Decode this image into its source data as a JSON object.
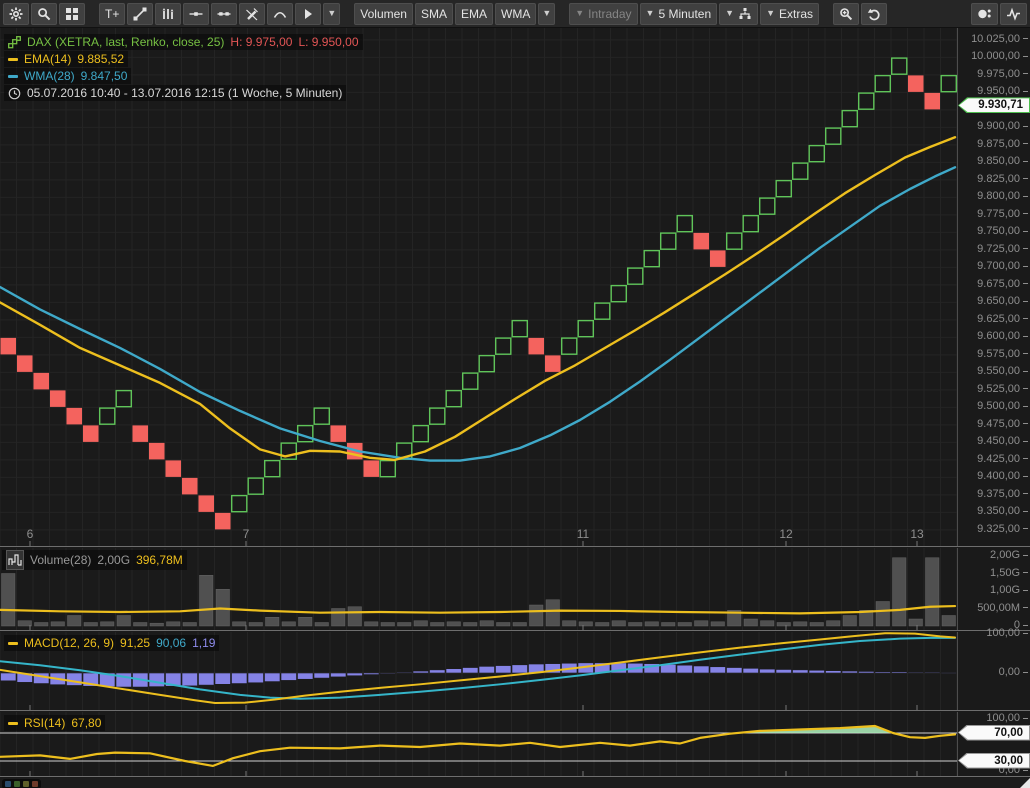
{
  "colors": {
    "up": "#5fc459",
    "down": "#f4635e",
    "ema": "#edbf1e",
    "wma": "#3fa9c9",
    "signal": "#35b5c9",
    "hist": "#8583e6",
    "volbar": "#505050",
    "rsi_fill": "#a9e7b6",
    "grid": "#242424",
    "axis_text": "#8f8f8f",
    "level_line": "#d0d0d0"
  },
  "toolbar": {
    "icons_left": [
      "gear-icon",
      "search-icon",
      "layout-grid-icon"
    ],
    "text_tool": "T+",
    "indicator_buttons": {
      "volumen": "Volumen",
      "sma": "SMA",
      "ema": "EMA",
      "wma": "WMA"
    },
    "dropdowns": {
      "intraday": "Intraday",
      "interval": "5 Minuten",
      "extras": "Extras"
    }
  },
  "legend": {
    "symbol": "DAX (XETRA, last, Renko, close, 25)",
    "high": "H: 9.975,00",
    "low": "L: 9.950,00",
    "ema_name": "EMA(14)",
    "ema_value": "9.885,52",
    "wma_name": "WMA(28)",
    "wma_value": "9.847,50",
    "range": "05.07.2016 10:40 - 13.07.2016 12:15 (1 Woche, 5 Minuten)"
  },
  "volume_legend": {
    "name": "Volume(28)",
    "scale": "2,00G",
    "value": "396,78M"
  },
  "macd_legend": {
    "name": "MACD(12, 26, 9)",
    "macd": "91,25",
    "signal": "90,06",
    "hist": "1,19"
  },
  "rsi_legend": {
    "name": "RSI(14)",
    "value": "67,80"
  },
  "price_tag": {
    "label": "9.930,71",
    "value": 9930.71
  },
  "chart_data": {
    "type": "renko+line",
    "x_labels": [
      [
        "6",
        30
      ],
      [
        "7",
        246
      ],
      [
        "11",
        583
      ],
      [
        "12",
        786
      ],
      [
        "13",
        917
      ]
    ],
    "main": {
      "brick_size": 25,
      "price_ticks": [
        [
          "10.025,00",
          10025
        ],
        [
          "10.000,00",
          10000
        ],
        [
          "9.975,00",
          9975
        ],
        [
          "9.950,00",
          9950
        ],
        [
          "9.900,00",
          9900
        ],
        [
          "9.875,00",
          9875
        ],
        [
          "9.850,00",
          9850
        ],
        [
          "9.825,00",
          9825
        ],
        [
          "9.800,00",
          9800
        ],
        [
          "9.775,00",
          9775
        ],
        [
          "9.750,00",
          9750
        ],
        [
          "9.725,00",
          9725
        ],
        [
          "9.700,00",
          9700
        ],
        [
          "9.675,00",
          9675
        ],
        [
          "9.650,00",
          9650
        ],
        [
          "9.625,00",
          9625
        ],
        [
          "9.600,00",
          9600
        ],
        [
          "9.575,00",
          9575
        ],
        [
          "9.550,00",
          9550
        ],
        [
          "9.525,00",
          9525
        ],
        [
          "9.500,00",
          9500
        ],
        [
          "9.475,00",
          9475
        ],
        [
          "9.450,00",
          9450
        ],
        [
          "9.425,00",
          9425
        ],
        [
          "9.400,00",
          9400
        ],
        [
          "9.375,00",
          9375
        ],
        [
          "9.350,00",
          9350
        ],
        [
          "9.325,00",
          9325
        ]
      ],
      "bricks": [
        [
          "d",
          9575
        ],
        [
          "d",
          9550
        ],
        [
          "d",
          9525
        ],
        [
          "d",
          9500
        ],
        [
          "d",
          9475
        ],
        [
          "d",
          9450
        ],
        [
          "u",
          9475
        ],
        [
          "u",
          9500
        ],
        [
          "d",
          9450
        ],
        [
          "d",
          9425
        ],
        [
          "d",
          9400
        ],
        [
          "d",
          9375
        ],
        [
          "d",
          9350
        ],
        [
          "d",
          9325
        ],
        [
          "u",
          9350
        ],
        [
          "u",
          9375
        ],
        [
          "u",
          9400
        ],
        [
          "u",
          9425
        ],
        [
          "u",
          9450
        ],
        [
          "u",
          9475
        ],
        [
          "d",
          9450
        ],
        [
          "d",
          9425
        ],
        [
          "d",
          9400
        ],
        [
          "u",
          9400
        ],
        [
          "u",
          9425
        ],
        [
          "u",
          9450
        ],
        [
          "u",
          9475
        ],
        [
          "u",
          9500
        ],
        [
          "u",
          9525
        ],
        [
          "u",
          9550
        ],
        [
          "u",
          9575
        ],
        [
          "u",
          9600
        ],
        [
          "d",
          9575
        ],
        [
          "d",
          9550
        ],
        [
          "u",
          9575
        ],
        [
          "u",
          9600
        ],
        [
          "u",
          9625
        ],
        [
          "u",
          9650
        ],
        [
          "u",
          9675
        ],
        [
          "u",
          9700
        ],
        [
          "u",
          9725
        ],
        [
          "u",
          9750
        ],
        [
          "d",
          9725
        ],
        [
          "d",
          9700
        ],
        [
          "u",
          9725
        ],
        [
          "u",
          9750
        ],
        [
          "u",
          9775
        ],
        [
          "u",
          9800
        ],
        [
          "u",
          9825
        ],
        [
          "u",
          9850
        ],
        [
          "u",
          9875
        ],
        [
          "u",
          9900
        ],
        [
          "u",
          9925
        ],
        [
          "u",
          9950
        ],
        [
          "u",
          9975
        ],
        [
          "d",
          9950
        ],
        [
          "d",
          9925
        ],
        [
          "u",
          9950
        ]
      ],
      "ema": [
        [
          0,
          9650
        ],
        [
          40,
          9618
        ],
        [
          80,
          9585
        ],
        [
          120,
          9560
        ],
        [
          160,
          9535
        ],
        [
          200,
          9505
        ],
        [
          230,
          9470
        ],
        [
          260,
          9440
        ],
        [
          285,
          9430
        ],
        [
          310,
          9438
        ],
        [
          340,
          9437
        ],
        [
          370,
          9428
        ],
        [
          395,
          9425
        ],
        [
          425,
          9437
        ],
        [
          455,
          9458
        ],
        [
          485,
          9485
        ],
        [
          515,
          9512
        ],
        [
          545,
          9538
        ],
        [
          575,
          9560
        ],
        [
          605,
          9585
        ],
        [
          635,
          9610
        ],
        [
          665,
          9636
        ],
        [
          695,
          9663
        ],
        [
          725,
          9690
        ],
        [
          755,
          9718
        ],
        [
          785,
          9747
        ],
        [
          815,
          9777
        ],
        [
          845,
          9806
        ],
        [
          875,
          9832
        ],
        [
          905,
          9857
        ],
        [
          930,
          9872
        ],
        [
          955,
          9886
        ]
      ],
      "wma": [
        [
          0,
          9672
        ],
        [
          40,
          9640
        ],
        [
          80,
          9612
        ],
        [
          120,
          9585
        ],
        [
          160,
          9555
        ],
        [
          200,
          9522
        ],
        [
          240,
          9495
        ],
        [
          280,
          9470
        ],
        [
          320,
          9452
        ],
        [
          360,
          9437
        ],
        [
          400,
          9428
        ],
        [
          430,
          9424
        ],
        [
          460,
          9424
        ],
        [
          490,
          9430
        ],
        [
          520,
          9442
        ],
        [
          550,
          9460
        ],
        [
          580,
          9482
        ],
        [
          610,
          9508
        ],
        [
          640,
          9537
        ],
        [
          670,
          9568
        ],
        [
          700,
          9600
        ],
        [
          730,
          9632
        ],
        [
          760,
          9664
        ],
        [
          790,
          9696
        ],
        [
          820,
          9728
        ],
        [
          850,
          9758
        ],
        [
          880,
          9788
        ],
        [
          910,
          9812
        ],
        [
          935,
          9830
        ],
        [
          955,
          9843
        ]
      ]
    },
    "volume": {
      "ticks": [
        [
          "2,00G",
          2
        ],
        [
          "1,50G",
          1.5
        ],
        [
          "1,00G",
          1
        ],
        [
          "500,00M",
          0.5
        ],
        [
          "0",
          0
        ]
      ],
      "bars": [
        1.5,
        0.15,
        0.1,
        0.12,
        0.3,
        0.1,
        0.12,
        0.3,
        0.1,
        0.08,
        0.12,
        0.1,
        1.45,
        1.05,
        0.12,
        0.1,
        0.25,
        0.12,
        0.25,
        0.1,
        0.5,
        0.55,
        0.12,
        0.1,
        0.1,
        0.15,
        0.1,
        0.12,
        0.1,
        0.15,
        0.1,
        0.1,
        0.6,
        0.75,
        0.15,
        0.12,
        0.1,
        0.15,
        0.1,
        0.12,
        0.1,
        0.1,
        0.15,
        0.12,
        0.45,
        0.2,
        0.15,
        0.1,
        0.12,
        0.1,
        0.15,
        0.3,
        0.45,
        0.7,
        1.95,
        0.2,
        1.95,
        0.3
      ],
      "ma": [
        [
          0,
          0.46
        ],
        [
          60,
          0.42
        ],
        [
          120,
          0.4
        ],
        [
          180,
          0.42
        ],
        [
          220,
          0.5
        ],
        [
          260,
          0.44
        ],
        [
          320,
          0.38
        ],
        [
          380,
          0.4
        ],
        [
          440,
          0.38
        ],
        [
          500,
          0.4
        ],
        [
          560,
          0.44
        ],
        [
          620,
          0.43
        ],
        [
          680,
          0.4
        ],
        [
          740,
          0.38
        ],
        [
          800,
          0.36
        ],
        [
          860,
          0.4
        ],
        [
          900,
          0.46
        ],
        [
          930,
          0.55
        ],
        [
          955,
          0.57
        ]
      ]
    },
    "macd": {
      "ticks": [
        [
          "100,00",
          100
        ],
        [
          "0,00",
          0
        ]
      ],
      "macd_line": [
        [
          0,
          8
        ],
        [
          40,
          -8
        ],
        [
          80,
          -24
        ],
        [
          120,
          -40
        ],
        [
          160,
          -56
        ],
        [
          195,
          -70
        ],
        [
          215,
          -77
        ],
        [
          245,
          -76
        ],
        [
          275,
          -68
        ],
        [
          305,
          -58
        ],
        [
          340,
          -48
        ],
        [
          380,
          -38
        ],
        [
          420,
          -29
        ],
        [
          460,
          -19
        ],
        [
          500,
          -9
        ],
        [
          540,
          2
        ],
        [
          580,
          14
        ],
        [
          620,
          27
        ],
        [
          660,
          40
        ],
        [
          700,
          53
        ],
        [
          740,
          65
        ],
        [
          780,
          76
        ],
        [
          820,
          86
        ],
        [
          855,
          95
        ],
        [
          885,
          102
        ],
        [
          915,
          101
        ],
        [
          940,
          94
        ],
        [
          955,
          91
        ]
      ],
      "signal_line": [
        [
          0,
          30
        ],
        [
          40,
          20
        ],
        [
          80,
          7
        ],
        [
          120,
          -8
        ],
        [
          160,
          -25
        ],
        [
          200,
          -42
        ],
        [
          240,
          -56
        ],
        [
          270,
          -63
        ],
        [
          300,
          -66
        ],
        [
          340,
          -63
        ],
        [
          380,
          -56
        ],
        [
          420,
          -48
        ],
        [
          460,
          -39
        ],
        [
          500,
          -29
        ],
        [
          540,
          -18
        ],
        [
          580,
          -6
        ],
        [
          620,
          7
        ],
        [
          660,
          20
        ],
        [
          700,
          34
        ],
        [
          740,
          47
        ],
        [
          780,
          60
        ],
        [
          820,
          72
        ],
        [
          860,
          82
        ],
        [
          900,
          88
        ],
        [
          930,
          90
        ],
        [
          955,
          90
        ]
      ],
      "hist": [
        -20,
        -24,
        -27,
        -30,
        -32,
        -34,
        -35,
        -36,
        -36,
        -35,
        -34,
        -33,
        -31,
        -29,
        -27,
        -25,
        -22,
        -19,
        -16,
        -13,
        -10,
        -7,
        -4,
        -1,
        2,
        5,
        8,
        11,
        14,
        17,
        19,
        21,
        23,
        24,
        25,
        26,
        26,
        26,
        25,
        24,
        22,
        20,
        18,
        16,
        14,
        12,
        10,
        9,
        8,
        7,
        6,
        5,
        4,
        3,
        3,
        2,
        2,
        1
      ]
    },
    "rsi": {
      "ticks": [
        [
          "100,00",
          100
        ],
        [
          "0,00",
          0
        ]
      ],
      "levels": [
        [
          "70,00",
          70
        ],
        [
          "30,00",
          30
        ]
      ],
      "points": [
        [
          0,
          36
        ],
        [
          40,
          38
        ],
        [
          70,
          33
        ],
        [
          97,
          40
        ],
        [
          115,
          42
        ],
        [
          150,
          41
        ],
        [
          185,
          30
        ],
        [
          213,
          23
        ],
        [
          233,
          34
        ],
        [
          260,
          44
        ],
        [
          290,
          49
        ],
        [
          340,
          48
        ],
        [
          380,
          52
        ],
        [
          420,
          50
        ],
        [
          460,
          55
        ],
        [
          500,
          52
        ],
        [
          530,
          56
        ],
        [
          560,
          50
        ],
        [
          600,
          56
        ],
        [
          630,
          52
        ],
        [
          660,
          58
        ],
        [
          680,
          55
        ],
        [
          700,
          63
        ],
        [
          730,
          69
        ],
        [
          760,
          73
        ],
        [
          800,
          75
        ],
        [
          840,
          77
        ],
        [
          875,
          80
        ],
        [
          893,
          70
        ],
        [
          910,
          64
        ],
        [
          925,
          63
        ],
        [
          940,
          66
        ],
        [
          955,
          68
        ]
      ]
    }
  }
}
